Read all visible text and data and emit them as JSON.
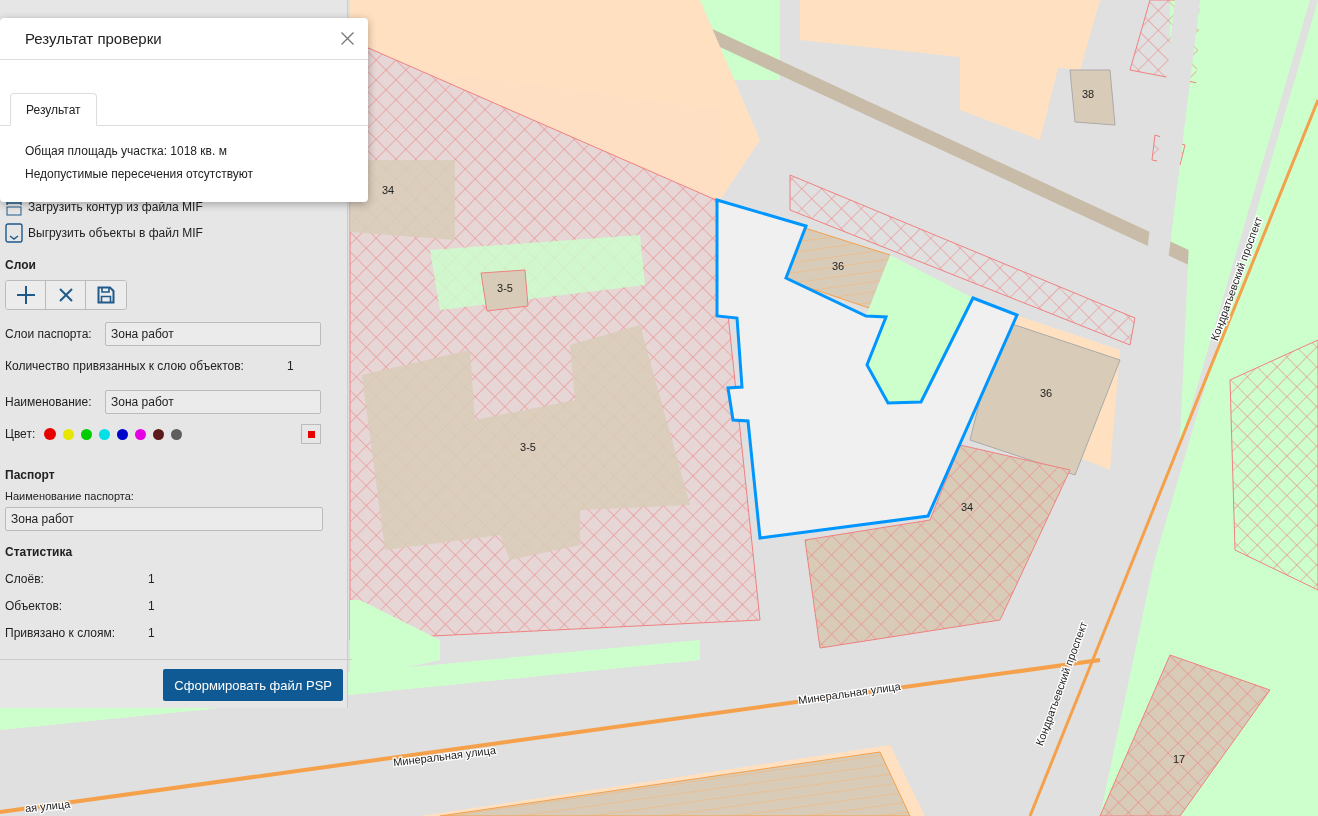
{
  "dialog": {
    "title": "Результат проверки",
    "tabs": [
      {
        "label": "Результат",
        "selected": true
      }
    ],
    "lines": [
      "Общая площадь участка: 1018 кв. м",
      "Недопустимые пересечения отсутствуют"
    ]
  },
  "panel": {
    "actions": [
      {
        "label": "Загрузить контур из файла MIF",
        "kind": "import"
      },
      {
        "label": "Выгрузить объекты в файл MIF",
        "kind": "export"
      }
    ],
    "layers": {
      "heading": "Слои",
      "passport_layers_label": "Слои паспорта:",
      "passport_layers_value": "Зона работ",
      "count_label": "Количество привязанных к слою объектов:",
      "count": "1",
      "name_label": "Наименование:",
      "name_value": "Зона работ",
      "color_label": "Цвет:",
      "colors": [
        {
          "color": "#e60000",
          "selected": true
        },
        {
          "color": "#e6e600",
          "selected": false
        },
        {
          "color": "#00cc00",
          "selected": false
        },
        {
          "color": "#00e0e6",
          "selected": false
        },
        {
          "color": "#0000cc",
          "selected": false
        },
        {
          "color": "#e600e6",
          "selected": false
        },
        {
          "color": "#5c1a1a",
          "selected": false
        },
        {
          "color": "#5e5e5e",
          "selected": false
        }
      ]
    },
    "passport": {
      "heading": "Паспорт",
      "name_label": "Наименование паспорта:",
      "name_value": "Зона работ"
    },
    "stats": {
      "heading": "Статистика",
      "rows": [
        {
          "label": "Слоёв:",
          "value": "1"
        },
        {
          "label": "Объектов:",
          "value": "1"
        },
        {
          "label": "Привязано к слоям:",
          "value": "1"
        }
      ]
    },
    "submit": "Сформировать файл PSP"
  },
  "map": {
    "labels": [
      "38",
      "34",
      "3-5",
      "36",
      "36",
      "3-5",
      "34",
      "17"
    ],
    "streets": [
      "Кондратьевский проспект",
      "Кондратьевский проспект",
      "Минеральная улица",
      "Минеральная улица",
      "ая улица"
    ]
  }
}
